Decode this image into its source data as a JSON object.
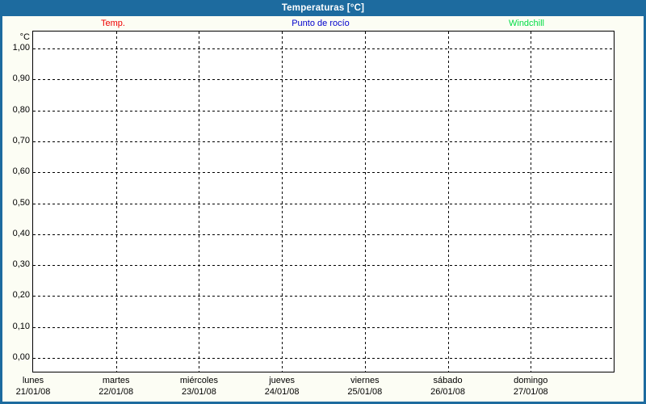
{
  "header": {
    "title": "Temperaturas [°C]",
    "bg_color": "#1d6b9f",
    "text_color": "#ffffff"
  },
  "legend": {
    "items": [
      {
        "label": "Temp.",
        "color": "#ee0000"
      },
      {
        "label": "Punto de rocío",
        "color": "#0000cc"
      },
      {
        "label": "Windchill",
        "color": "#00dd44"
      }
    ]
  },
  "chart_data": {
    "type": "line",
    "title": "Temperaturas [°C]",
    "ylabel": "°C",
    "ylim": [
      0.0,
      1.0
    ],
    "ytick_step": 0.1,
    "ytick_labels": [
      "1,00",
      "0,90",
      "0,80",
      "0,70",
      "0,60",
      "0,50",
      "0,40",
      "0,30",
      "0,20",
      "0,10",
      "0,00"
    ],
    "grid": "dashed horizontal line at every 0,10; dashed vertical line at each day boundary",
    "legend_position": "top",
    "categories": [
      {
        "day": "lunes",
        "date": "21/01/08"
      },
      {
        "day": "martes",
        "date": "22/01/08"
      },
      {
        "day": "miércoles",
        "date": "23/01/08"
      },
      {
        "day": "jueves",
        "date": "24/01/08"
      },
      {
        "day": "viernes",
        "date": "25/01/08"
      },
      {
        "day": "sábado",
        "date": "26/01/08"
      },
      {
        "day": "domingo",
        "date": "27/01/08"
      }
    ],
    "series": [
      {
        "name": "Temp.",
        "color": "#ee0000",
        "values": []
      },
      {
        "name": "Punto de rocío",
        "color": "#0000cc",
        "values": []
      },
      {
        "name": "Windchill",
        "color": "#00dd44",
        "values": []
      }
    ],
    "note": "plot area is empty — no data points drawn"
  }
}
